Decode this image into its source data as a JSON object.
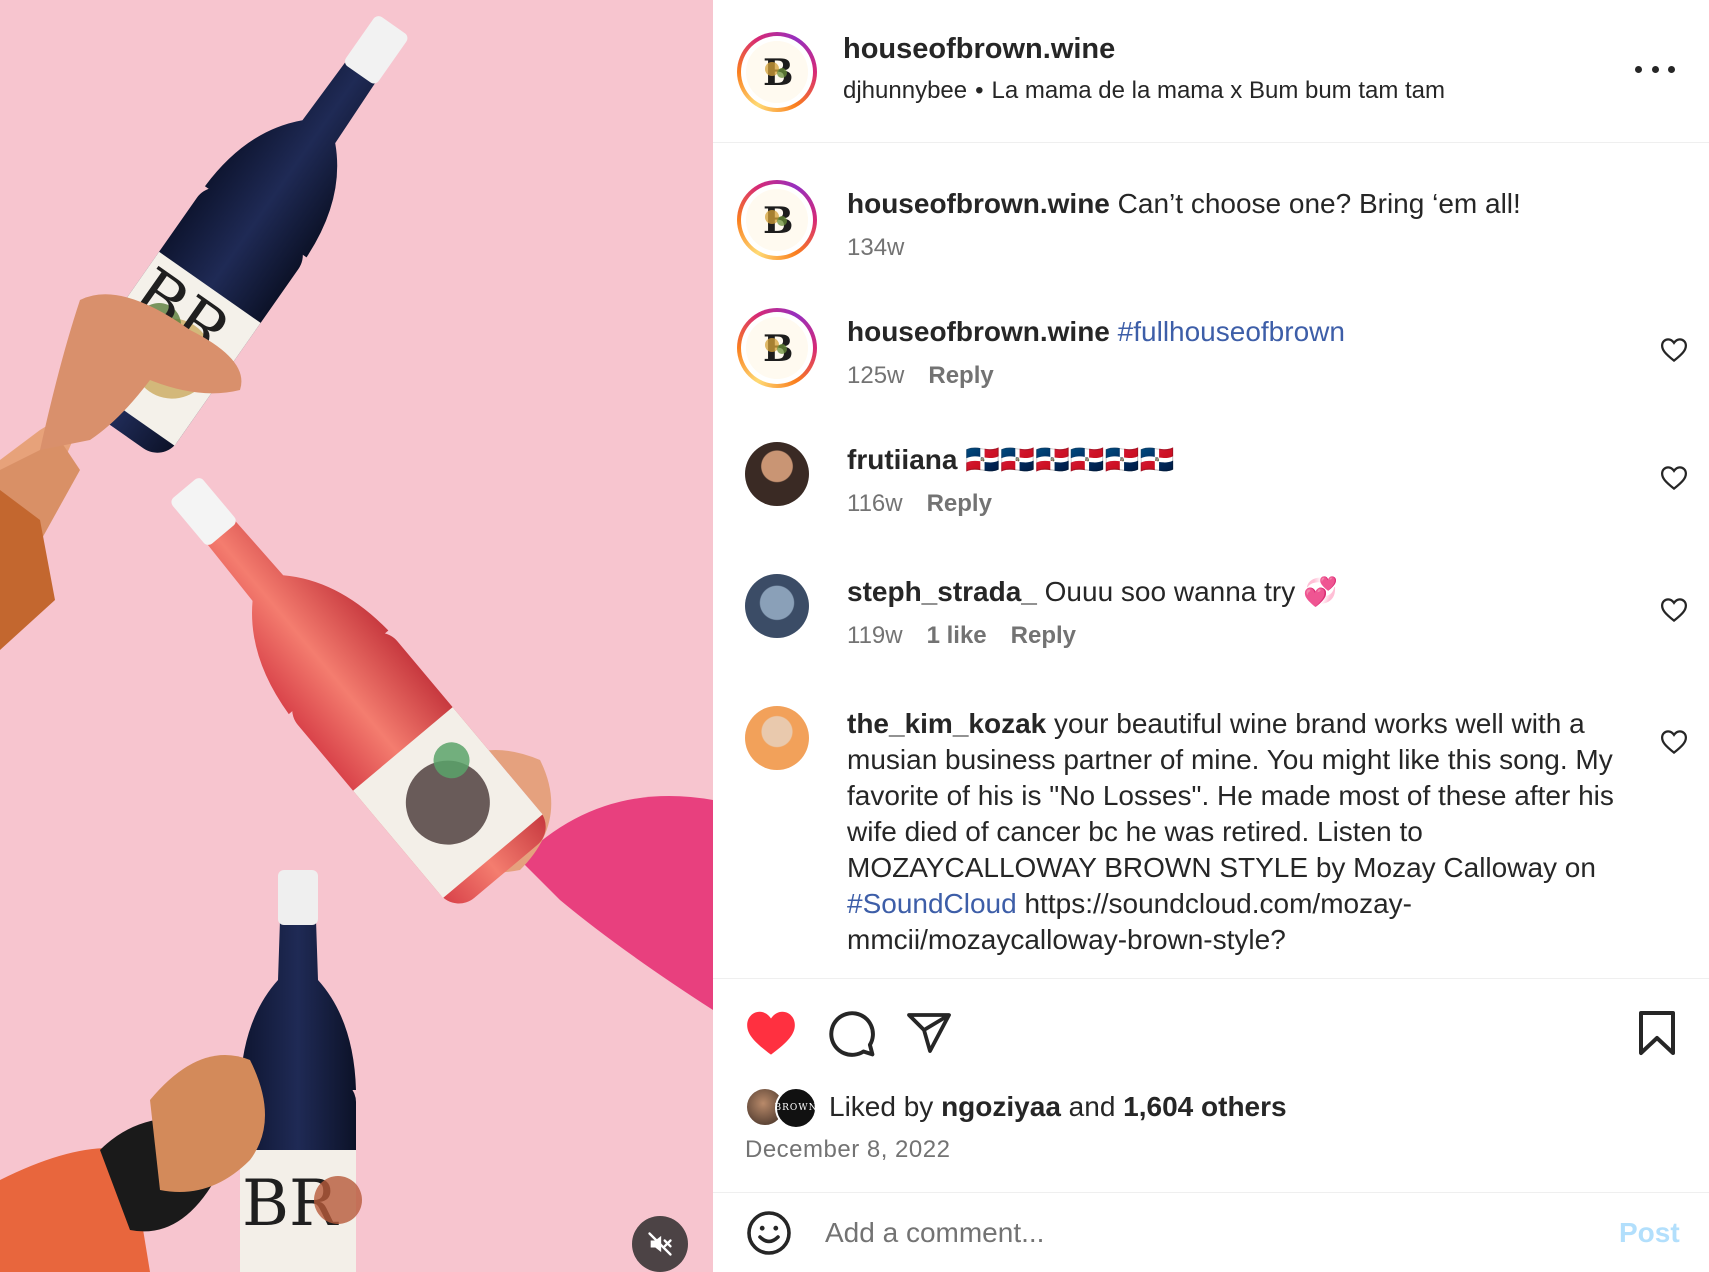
{
  "post": {
    "author": "houseofbrown.wine",
    "audio": {
      "artist": "djhunnybee",
      "separator": "•",
      "track": "La mama de la mama x Bum bum tam tam"
    },
    "media": {
      "mute_icon": "speaker-muted-icon",
      "background_color": "#f7c5cf"
    }
  },
  "comments": [
    {
      "username": "houseofbrown.wine",
      "text": "Can’t choose one? Bring ‘em all!",
      "time": "134w",
      "is_caption": true
    },
    {
      "username": "houseofbrown.wine",
      "text": "#fullhouseofbrown",
      "time": "125w",
      "reply": "Reply"
    },
    {
      "username": "frutiiana",
      "text": "🇩🇴🇩🇴🇩🇴🇩🇴🇩🇴🇩🇴",
      "time": "116w",
      "reply": "Reply"
    },
    {
      "username": "steph_strada_",
      "text": "Ouuu soo wanna try 💞",
      "time": "119w",
      "likes": "1 like",
      "reply": "Reply"
    },
    {
      "username": "the_kim_kozak",
      "text": "your beautiful wine brand works well with a musian business partner of mine. You might like this song. My favorite of his is \"No Losses\". He made most of these after his wife died of cancer bc he was retired. Listen to MOZAYCALLOWAY BROWN STYLE by Mozay Calloway on",
      "hashtag": "#SoundCloud",
      "link": "https://soundcloud.com/mozay-mmcii/mozaycalloway-brown-style?"
    }
  ],
  "actions": {
    "like_icon": "heart-filled-icon",
    "comment_icon": "comment-bubble-icon",
    "share_icon": "paper-plane-icon",
    "save_icon": "bookmark-icon",
    "liked_state": true,
    "like_color": "#ff3040"
  },
  "likes": {
    "prefix": "Liked by",
    "user": "ngoziyaa",
    "conjunction": "and",
    "others": "1,604 others",
    "avatar_badge": "BROWN"
  },
  "date": "December 8, 2022",
  "composer": {
    "emoji_icon": "smiley-icon",
    "placeholder": "Add a comment...",
    "post_label": "Post"
  }
}
